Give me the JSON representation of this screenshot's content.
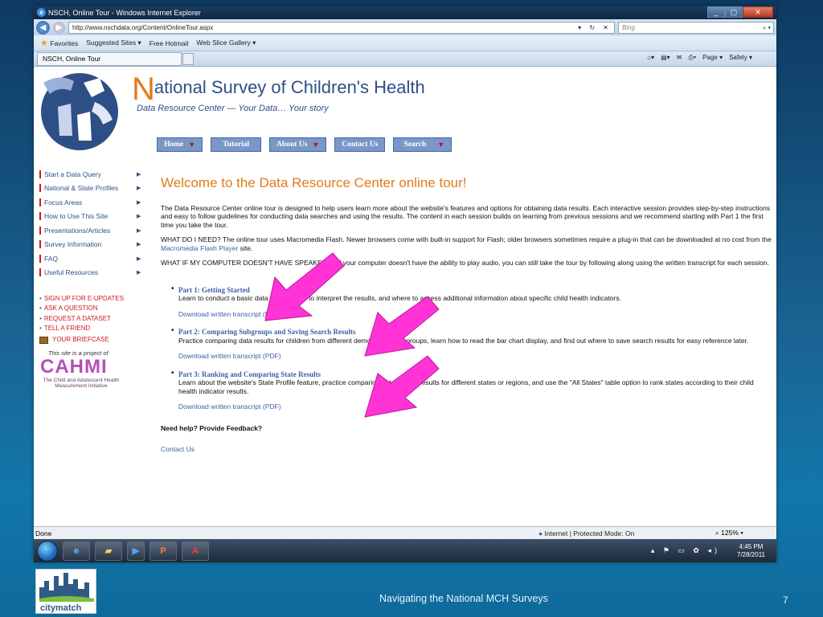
{
  "browser": {
    "window_title": "NSCH, Online Tour - Windows Internet Explorer",
    "url": "http://www.nschdata.org/Content/OnlineTour.aspx",
    "search_placeholder": "Bing",
    "favorites": [
      "Favorites",
      "Suggested Sites ▾",
      "Free Hotmail",
      "Web Slice Gallery ▾"
    ],
    "tab_title": "NSCH, Online Tour",
    "commands": [
      "Page ▾",
      "Safety ▾"
    ],
    "status_left": "Done",
    "status_zone": "Internet | Protected Mode: On",
    "zoom": "125%"
  },
  "site": {
    "title_first": "N",
    "title_rest": "ational Survey of Children's Health",
    "tagline": "Data Resource Center — Your Data… Your story",
    "nav": [
      {
        "label": "Home",
        "dropdown": true
      },
      {
        "label": "Tutorial",
        "dropdown": false
      },
      {
        "label": "About Us",
        "dropdown": true
      },
      {
        "label": "Contact Us",
        "dropdown": false
      },
      {
        "label": "Search",
        "dropdown": true
      }
    ],
    "sidebar": [
      "Start a Data Query",
      "National & State Profiles",
      "Focus Areas",
      "How to Use This Site",
      "Presentations/Articles",
      "Survey Information",
      "FAQ",
      "Useful Resources"
    ],
    "quick_links": [
      "SIGN UP FOR E-UPDATES",
      "ASK A QUESTION",
      "REQUEST A DATASET",
      "TELL A FRIEND"
    ],
    "briefcase": "YOUR BRIEFCASE",
    "cahmi_project": "This site is a project of",
    "cahmi_name": "CAHMI",
    "cahmi_sub": "The Child and Adolescent Health Measurement Initiative"
  },
  "main": {
    "heading": "Welcome to the Data Resource Center online tour!",
    "intro": "The Data Resource Center online tour is designed to help users learn more about the website's features and options for obtaining data results. Each interactive session provides step-by-step instructions and easy to follow guidelines for conducting data searches and using the results. The content in each session builds on learning from previous sessions and we recommend starting with Part 1 the first time you take the tour.",
    "need_a": "WHAT DO I NEED? The online tour uses Macromedia Flash. Newer browsers come with built-in support for Flash; older browsers sometimes require a plug-in that can be downloaded at no cost from the ",
    "need_link": "Macromedia Flash Player",
    "need_b": " site.",
    "speakers": "WHAT IF MY COMPUTER DOESN'T HAVE SPEAKERS? If your computer doesn't have the ability to play audio, you can still take the tour by following along using the written transcript for each session.",
    "parts": [
      {
        "title": "Part 1: Getting Started",
        "desc": "Learn to conduct a basic data search, how to interpret the results, and where to access additional information about specific child health indicators.",
        "download": "Download written transcript (PDF)"
      },
      {
        "title": "Part 2: Comparing Subgroups and Saving Search Results",
        "desc": "Practice comparing data results for children from different demographic subgroups, learn how to read the bar chart display, and find out where to save search results for easy reference later.",
        "download": "Download written transcript (PDF)"
      },
      {
        "title": "Part 3: Ranking and Comparing State Results",
        "desc": "Learn about the website's State Profile feature, practice comparing data search results for different states or regions, and use the \"All States\" table option to rank states according to their child health indicator results.",
        "download": "Download written transcript (PDF)"
      }
    ],
    "help": "Need help? Provide Feedback?",
    "contact": "Contact Us"
  },
  "taskbar": {
    "time": "4:45 PM",
    "date": "7/28/2011"
  },
  "slide": {
    "footer": "Navigating the National MCH Surveys",
    "page_number": "7",
    "logo_text": "citymatch"
  },
  "colors": {
    "orange": "#e07b1a",
    "navy": "#2e4f86",
    "red": "#cc1a22",
    "pink_arrow": "#ff33d6"
  }
}
